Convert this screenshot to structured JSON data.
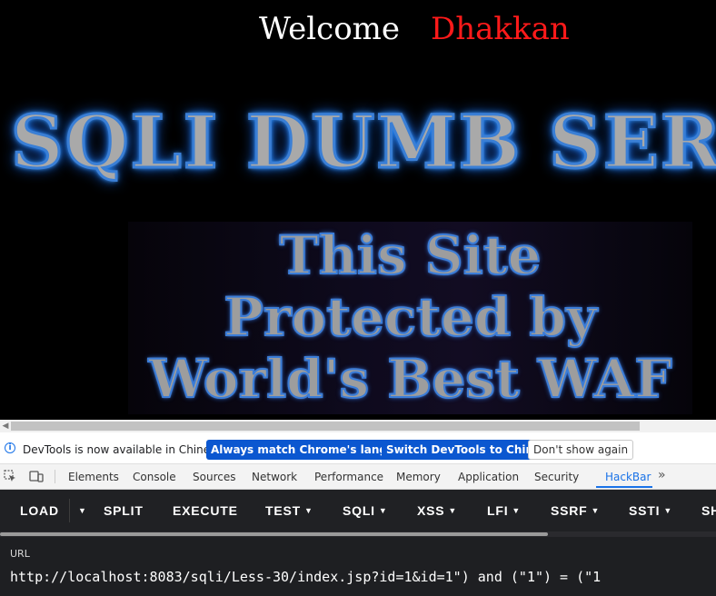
{
  "page": {
    "welcome_label": "Welcome",
    "welcome_user": "Dhakkan",
    "banner_text": "SQLI DUMB SER",
    "waf_lines": [
      "This Site",
      "Protected by",
      "World's Best WAF"
    ]
  },
  "devtools": {
    "infobar": {
      "message": "DevTools is now available in Chinese!",
      "buttons": [
        "Always match Chrome's language",
        "Switch DevTools to Chinese",
        "Don't show again"
      ]
    },
    "tabs": [
      "Elements",
      "Console",
      "Sources",
      "Network",
      "Performance",
      "Memory",
      "Application",
      "Security",
      "HackBar"
    ],
    "active_tab": "HackBar",
    "more_icon": "chevron-double-right-icon"
  },
  "hackbar": {
    "buttons": [
      "LOAD",
      "SPLIT",
      "EXECUTE",
      "TEST",
      "SQLI",
      "XSS",
      "LFI",
      "SSRF",
      "SSTI",
      "SH"
    ],
    "url_label": "URL",
    "url_value": "http://localhost:8083/sqli/Less-30/index.jsp?id=1&id=1\") and (\"1\") = (\"1"
  },
  "colors": {
    "welcome_user": "#ff1a1a",
    "accent": "#1a73e8",
    "primary_button": "#0b57d0",
    "hackbar_bg": "#1e1f22"
  }
}
